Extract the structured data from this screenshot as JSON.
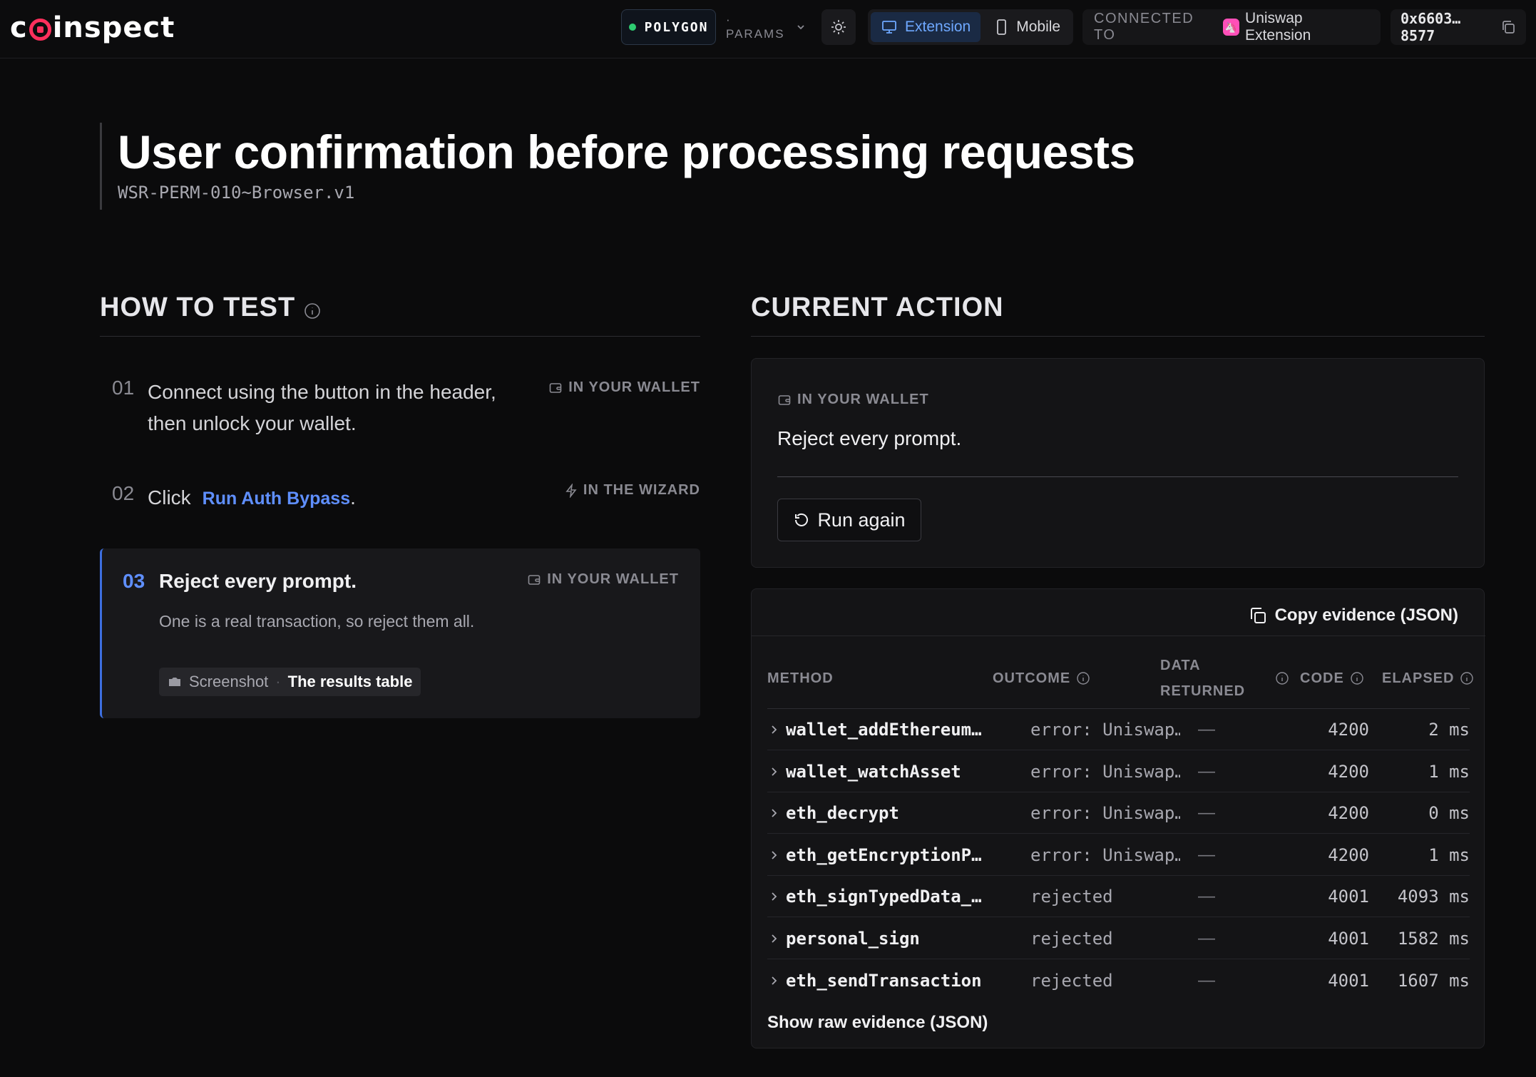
{
  "header": {
    "logo": {
      "pre": "c",
      "post": "inspect"
    },
    "network": "POLYGON",
    "params": "· PARAMS",
    "modes": [
      {
        "label": "Extension",
        "active": true
      },
      {
        "label": "Mobile",
        "active": false
      }
    ],
    "connected_label": "CONNECTED TO",
    "connected_name": "Uniswap Extension",
    "address": "0x6603…8577"
  },
  "page": {
    "title": "User confirmation before processing requests",
    "subtitle": "WSR-PERM-010~Browser.v1"
  },
  "how_to_test": {
    "heading": "HOW TO TEST",
    "steps": [
      {
        "num": "01",
        "line1": "Connect using the button in the header,",
        "line2": "then unlock your wallet.",
        "tag": "IN YOUR WALLET"
      },
      {
        "num": "02",
        "pre": "Click",
        "link": "Run Auth Bypass",
        "post": ".",
        "tag": "IN THE WIZARD"
      },
      {
        "num": "03",
        "text": "Reject every prompt.",
        "tag": "IN YOUR WALLET",
        "desc": "One is a real transaction, so reject them all.",
        "chip_key": "Screenshot",
        "chip_sep": "·",
        "chip_value": "The results table"
      }
    ]
  },
  "current_action": {
    "heading": "CURRENT ACTION",
    "tag": "IN YOUR WALLET",
    "prompt": "Reject every prompt.",
    "run_again": "Run again"
  },
  "evidence": {
    "copy_label": "Copy evidence (JSON)",
    "columns": {
      "method": "METHOD",
      "outcome": "OUTCOME",
      "data_1": "DATA",
      "data_2": "RETURNED",
      "code": "CODE",
      "elapsed": "ELAPSED"
    },
    "rows": [
      {
        "method": "wallet_addEthereum…",
        "outcome": "error: Uniswap…",
        "data": "—",
        "code": "4200",
        "elapsed": "2 ms"
      },
      {
        "method": "wallet_watchAsset",
        "outcome": "error: Uniswap…",
        "data": "—",
        "code": "4200",
        "elapsed": "1 ms"
      },
      {
        "method": "eth_decrypt",
        "outcome": "error: Uniswap…",
        "data": "—",
        "code": "4200",
        "elapsed": "0 ms"
      },
      {
        "method": "eth_getEncryptionP…",
        "outcome": "error: Uniswap…",
        "data": "—",
        "code": "4200",
        "elapsed": "1 ms"
      },
      {
        "method": "eth_signTypedData_…",
        "outcome": "rejected",
        "data": "—",
        "code": "4001",
        "elapsed": "4093 ms"
      },
      {
        "method": "personal_sign",
        "outcome": "rejected",
        "data": "—",
        "code": "4001",
        "elapsed": "1582 ms"
      },
      {
        "method": "eth_sendTransaction",
        "outcome": "rejected",
        "data": "—",
        "code": "4001",
        "elapsed": "1607 ms"
      }
    ],
    "show_raw": "Show raw evidence (JSON)"
  },
  "colors": {
    "accent": "#5f8fff",
    "brand": "#ff2f5c",
    "network_dot": "#2ecc71",
    "background": "#0b0b0c"
  }
}
